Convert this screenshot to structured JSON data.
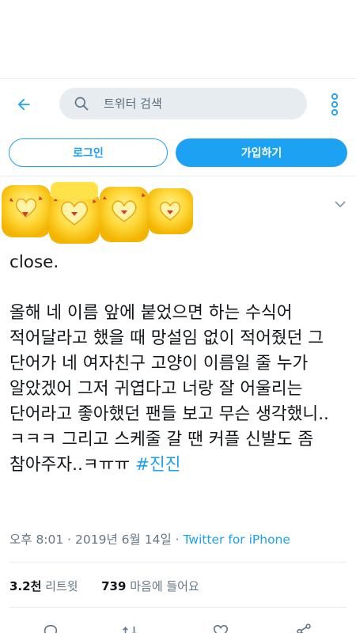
{
  "header": {
    "back_icon": "back-arrow-icon",
    "search_placeholder": "트위터 검색",
    "search_icon": "search-icon",
    "more_icon": "more-vertical-icon",
    "accent": "#1da1f2"
  },
  "auth": {
    "login_label": "로그인",
    "signup_label": "가입하기"
  },
  "tweet": {
    "avatar": "heart-stickers",
    "text_plain": "close.\n\n올해 네 이름 앞에 붙었으면 하는 수식어 적어달라고 했을 때 망설임 없이 적어줬던 그 단어가 네 여자친구 고양이 이름일 줄 누가 알았겠어 그저 귀엽다고 너랑 잘 어울리는 단어라고 좋아했던 팬들 보고 무슨 생각했니..ㅋㅋㅋ 그리고 스케줄 갈 땐 커플 신발도 좀 참아주자..ㅋㅠㅠ ",
    "hashtag": "#진진",
    "timestamp": "오후 8:01 · 2019년 6월 14일 · ",
    "source": "Twitter for iPhone"
  },
  "stats": {
    "retweets_count": "3.2천",
    "retweets_label": "리트윗",
    "likes_count": "739",
    "likes_label": "마음에 들어요"
  },
  "actions": [
    "reply-icon",
    "retweet-icon",
    "like-icon",
    "share-icon"
  ]
}
